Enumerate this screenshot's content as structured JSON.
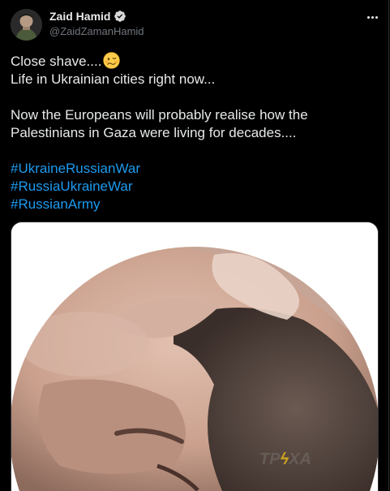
{
  "author": {
    "display_name": "Zaid Hamid",
    "handle": "@ZaidZamanHamid",
    "verified": true,
    "avatar_icon": "avatar-photo"
  },
  "tweet": {
    "lines": [
      "Close shave....",
      "Life in Ukrainian cities right now..."
    ],
    "paragraph2": [
      "Now the Europeans will probably realise how the",
      "Palestinians in Gaza were living for decades...."
    ],
    "hashtags": [
      "#UkraineRussianWar",
      "#RussiaUkraineWar",
      "#RussianArmy"
    ],
    "emoji": "woozy-face-emoji"
  },
  "media": {
    "watermark_left": "TP",
    "watermark_bolt": "ϟ",
    "watermark_right": "XA"
  },
  "colors": {
    "background": "#000000",
    "text": "#e7e9ea",
    "secondary": "#71767b",
    "link": "#1d9bf0",
    "verified": "#d9d9d9"
  },
  "icons": {
    "more": "more-horizontal-icon",
    "verified": "verified-badge-icon"
  }
}
